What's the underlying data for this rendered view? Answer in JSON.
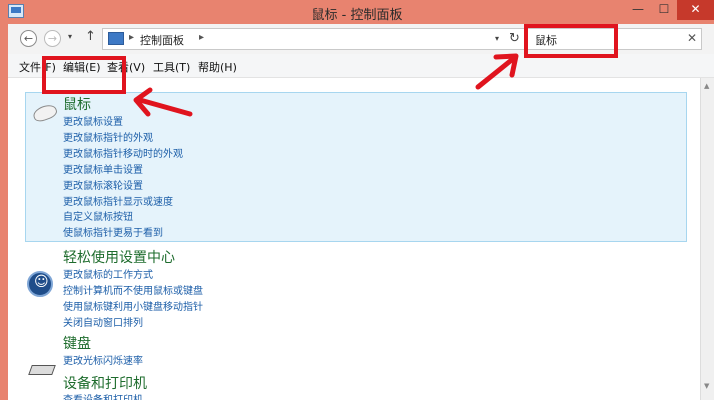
{
  "window": {
    "title": "鼠标 - 控制面板",
    "min_glyph": "—",
    "max_glyph": "☐",
    "close_glyph": "✕"
  },
  "address": {
    "breadcrumb": "控制面板",
    "separator": "▸",
    "search_query": "鼠标",
    "clear_glyph": "✕",
    "refresh_glyph": "↻",
    "dropdown_glyph": "▾",
    "back_glyph": "←",
    "forward_glyph": "→",
    "up_glyph": "↑"
  },
  "menu": {
    "file": "文件(F)",
    "edit": "编辑(E)",
    "view": "查看(V)",
    "tools": "工具(T)",
    "help": "帮助(H)"
  },
  "results": [
    {
      "title": "鼠标",
      "icon": "mouse-icon",
      "links": [
        "更改鼠标设置",
        "更改鼠标指针的外观",
        "更改鼠标指针移动时的外观",
        "更改鼠标单击设置",
        "更改鼠标滚轮设置",
        "更改鼠标指针显示或速度",
        "自定义鼠标按钮",
        "使鼠标指针更易于看到"
      ]
    },
    {
      "title": "轻松使用设置中心",
      "icon": "ease-of-access-icon",
      "links": [
        "更改鼠标的工作方式",
        "控制计算机而不使用鼠标或键盘",
        "使用鼠标键利用小键盘移动指针",
        "关闭自动窗口排列"
      ]
    },
    {
      "title": "键盘",
      "icon": "keyboard-icon",
      "links": [
        "更改光标闪烁速率"
      ]
    },
    {
      "title": "设备和打印机",
      "icon": "printer-icon",
      "links": [
        "查看设备和打印机"
      ]
    }
  ],
  "colors": {
    "frame": "#e8836f",
    "close_button": "#c6392b",
    "highlight": "#e0141e",
    "group_title": "#1e6c2d",
    "link": "#1c5ea8",
    "selection": "#e5f3fb"
  }
}
